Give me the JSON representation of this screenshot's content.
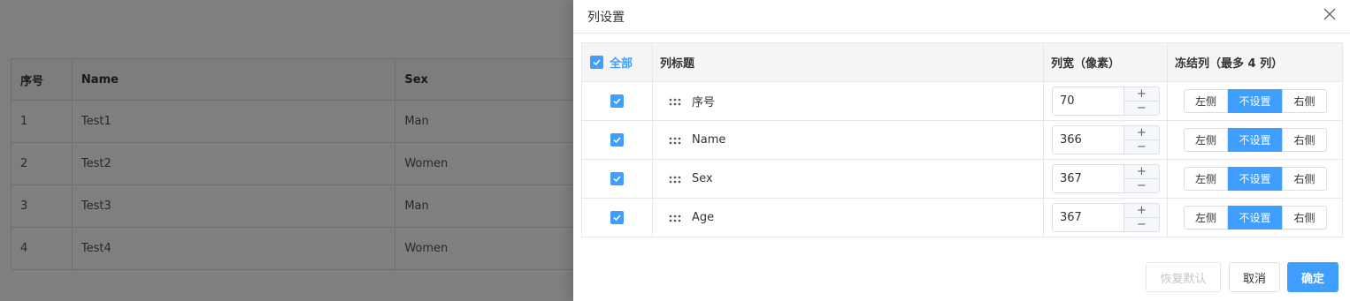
{
  "background_table": {
    "headers": [
      "序号",
      "Name",
      "Sex"
    ],
    "rows": [
      [
        "1",
        "Test1",
        "Man"
      ],
      [
        "2",
        "Test2",
        "Women"
      ],
      [
        "3",
        "Test3",
        "Man"
      ],
      [
        "4",
        "Test4",
        "Women"
      ]
    ]
  },
  "drawer": {
    "title": "列设置",
    "close_icon": "close-icon",
    "table": {
      "select_all_label": "全部",
      "headers": {
        "title": "列标题",
        "width": "列宽（像素）",
        "freeze": "冻结列（最多 4 列）"
      },
      "rows": [
        {
          "title": "序号",
          "width": "70",
          "checked": true,
          "freeze": "不设置"
        },
        {
          "title": "Name",
          "width": "366",
          "checked": true,
          "freeze": "不设置"
        },
        {
          "title": "Sex",
          "width": "367",
          "checked": true,
          "freeze": "不设置"
        },
        {
          "title": "Age",
          "width": "367",
          "checked": true,
          "freeze": "不设置"
        }
      ],
      "stepper": {
        "plus": "+",
        "minus": "−"
      },
      "freeze_options": {
        "left": "左侧",
        "none": "不设置",
        "right": "右侧"
      }
    },
    "footer": {
      "reset_label": "恢复默认",
      "cancel_label": "取消",
      "ok_label": "确定"
    }
  },
  "colors": {
    "primary": "#409eff",
    "overlay": "rgba(0,0,0,0.5)"
  }
}
